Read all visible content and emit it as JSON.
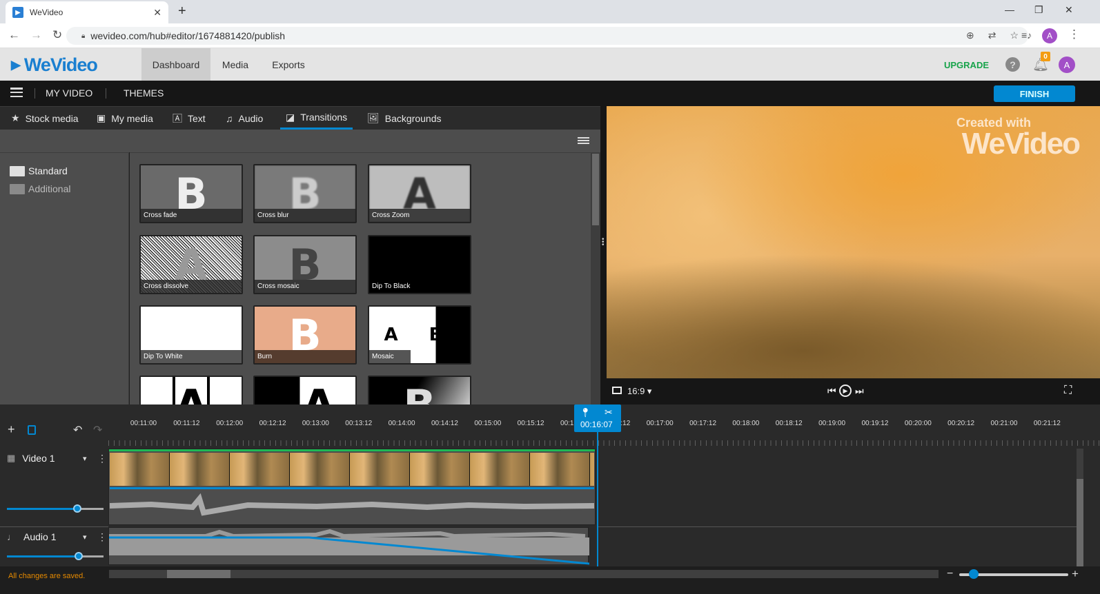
{
  "browser": {
    "tab_title": "WeVideo",
    "url": "wevideo.com/hub#editor/1674881420/publish",
    "profile_initial": "A"
  },
  "header": {
    "logo": "WeVideo",
    "nav": [
      {
        "label": "Dashboard",
        "active": true
      },
      {
        "label": "Media",
        "active": false
      },
      {
        "label": "Exports",
        "active": false
      }
    ],
    "upgrade_label": "UPGRADE",
    "notifications_count": "0",
    "avatar_initial": "A",
    "colors": {
      "upgrade": "#17a34a",
      "badge": "#f39c12",
      "avatar": "#a24fc7"
    }
  },
  "toolbar": {
    "my_video": "MY VIDEO",
    "themes": "THEMES",
    "finish_label": "FINISH",
    "accent": "#0288d1"
  },
  "media_tabs": [
    {
      "label": "Stock media",
      "icon": "star-icon",
      "active": false
    },
    {
      "label": "My media",
      "icon": "folder-star-icon",
      "active": false
    },
    {
      "label": "Text",
      "icon": "text-icon",
      "active": false
    },
    {
      "label": "Audio",
      "icon": "music-icon",
      "active": false
    },
    {
      "label": "Transitions",
      "icon": "transition-icon",
      "active": true
    },
    {
      "label": "Backgrounds",
      "icon": "image-icon",
      "active": false
    }
  ],
  "categories": [
    {
      "label": "Standard",
      "selected": true
    },
    {
      "label": "Additional",
      "selected": false
    }
  ],
  "transitions": [
    {
      "label": "Cross fade",
      "glyph": "B"
    },
    {
      "label": "Cross blur",
      "glyph": "B"
    },
    {
      "label": "Cross Zoom",
      "glyph": "A"
    },
    {
      "label": "Cross dissolve",
      "glyph": "A"
    },
    {
      "label": "Cross mosaic",
      "glyph": "B"
    },
    {
      "label": "Dip To Black",
      "glyph": ""
    },
    {
      "label": "Dip To White",
      "glyph": ""
    },
    {
      "label": "Burn",
      "glyph": "B"
    },
    {
      "label": "Mosaic",
      "glyph": "A B"
    },
    {
      "label": "",
      "glyph": "A"
    },
    {
      "label": "",
      "glyph": "B A"
    },
    {
      "label": "",
      "glyph": "B"
    }
  ],
  "preview": {
    "watermark_small": "Created with",
    "watermark_big": "WeVideo",
    "aspect_ratio": "16:9"
  },
  "timeline": {
    "ticks": [
      "00:11:00",
      "00:11:12",
      "00:12:00",
      "00:12:12",
      "00:13:00",
      "00:13:12",
      "00:14:00",
      "00:14:12",
      "00:15:00",
      "00:15:12",
      "00:16:00",
      "00:16:12",
      "00:17:00",
      "00:17:12",
      "00:18:00",
      "00:18:12",
      "00:19:00",
      "00:19:12",
      "00:20:00",
      "00:20:12",
      "00:21:00",
      "00:21:12"
    ],
    "playhead_time": "00:16:07",
    "tracks": [
      {
        "name": "Video 1",
        "icon": "film-icon",
        "volume": 0.73
      },
      {
        "name": "Audio 1",
        "icon": "music-note-icon",
        "volume": 0.74
      }
    ],
    "zoom_level": 0.13
  },
  "status": {
    "saved_text": "All changes are saved."
  }
}
